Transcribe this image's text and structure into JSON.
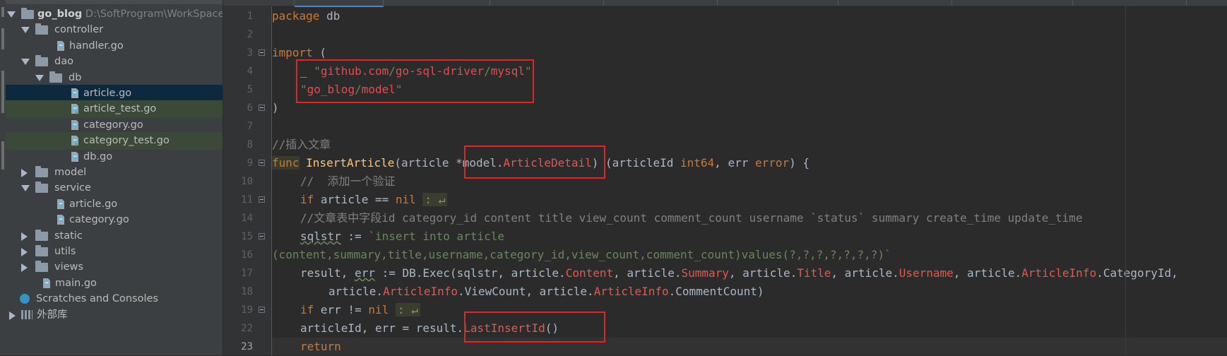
{
  "project": {
    "root_name": "go_blog",
    "root_path": "D:\\SoftProgram\\WorkSpace\\",
    "tree": [
      {
        "label": "controller",
        "kind": "folder",
        "expanded": true
      },
      {
        "label": "handler.go",
        "kind": "go-file"
      },
      {
        "label": "dao",
        "kind": "folder",
        "expanded": true
      },
      {
        "label": "db",
        "kind": "folder",
        "expanded": true
      },
      {
        "label": "article.go",
        "kind": "go-file",
        "selected": true
      },
      {
        "label": "article_test.go",
        "kind": "go-test-file"
      },
      {
        "label": "category.go",
        "kind": "go-file"
      },
      {
        "label": "category_test.go",
        "kind": "go-test-file"
      },
      {
        "label": "db.go",
        "kind": "go-file"
      },
      {
        "label": "model",
        "kind": "folder",
        "expanded": false
      },
      {
        "label": "service",
        "kind": "folder",
        "expanded": true
      },
      {
        "label": "article.go",
        "kind": "go-file"
      },
      {
        "label": "category.go",
        "kind": "go-file"
      },
      {
        "label": "static",
        "kind": "folder",
        "expanded": false
      },
      {
        "label": "utils",
        "kind": "folder",
        "expanded": false
      },
      {
        "label": "views",
        "kind": "folder",
        "expanded": false
      },
      {
        "label": "main.go",
        "kind": "go-file"
      }
    ],
    "scratches_label": "Scratches and Consoles",
    "external_libraries_label": "外部库"
  },
  "editor": {
    "line_numbers": [
      "1",
      "2",
      "3",
      "4",
      "5",
      "6",
      "7",
      "8",
      "9",
      "10",
      "11",
      "14",
      "15",
      "16",
      "17",
      "18",
      "19",
      "22",
      "23"
    ],
    "current_line": "23",
    "code": {
      "l1_kw": "package",
      "l1_rest": " db",
      "l3_kw": "import",
      "l3_rest": " (",
      "l4_blank": "_ ",
      "l4_q1": "\"",
      "l4_p1": "github.com",
      "l4_s1": "/",
      "l4_p2": "go-sql-driver",
      "l4_s2": "/",
      "l4_p3": "mysql",
      "l4_q2": "\"",
      "l5_q1": "\"",
      "l5_p1": "go_blog",
      "l5_s1": "/",
      "l5_p2": "model",
      "l5_q2": "\"",
      "l6": ")",
      "l8": "//插入文章",
      "l9_kw": "func",
      "l9_fn": "InsertArticle",
      "l9_a": "(article *model.",
      "l9_type": "ArticleDetail",
      "l9_b": ") (articleId ",
      "l9_t1": "int64",
      "l9_c": ", err ",
      "l9_t2": "error",
      "l9_d": ") {",
      "l10": "//  添加一个验证",
      "l11_kw": "if",
      "l11_rest": " article == ",
      "l11_nil": "nil",
      "l11_hint": ": ↵",
      "l14": "//文章表中字段id category_id content title view_count comment_count username `status` summary create_time update_time",
      "l15_var": "sqlstr",
      "l15_op": " := ",
      "l15_str": "`insert into article",
      "l16_str": "(content,summary,title,username,category_id,view_count,comment_count)values(?,?,?,?,?,?,?)`",
      "l17_a": "result, ",
      "l17_err": "err",
      "l17_b": " := DB.Exec(sqlstr, article.",
      "l17_f1": "Content",
      "l17_c": ", article.",
      "l17_f2": "Summary",
      "l17_d": ", article.",
      "l17_f3": "Title",
      "l17_e": ", article.",
      "l17_f4": "Username",
      "l17_f": ", article.",
      "l17_f5": "ArticleInfo",
      "l17_g": ".CategoryId,",
      "l18_a": "article.",
      "l18_f1": "ArticleInfo",
      "l18_b": ".ViewCount, article.",
      "l18_f2": "ArticleInfo",
      "l18_c": ".CommentCount)",
      "l19_kw": "if",
      "l19_rest": " err != ",
      "l19_nil": "nil",
      "l19_hint": ": ↵",
      "l22_a": "articleId, err = result.",
      "l22_fn": "LastInsertId",
      "l22_b": "()",
      "l23_kw": "return"
    }
  },
  "colors": {
    "background": "#2b2b2b",
    "keyword": "#cc7832",
    "comment": "#808080",
    "function": "#ffc66d",
    "annotation_box": "#e52424"
  }
}
